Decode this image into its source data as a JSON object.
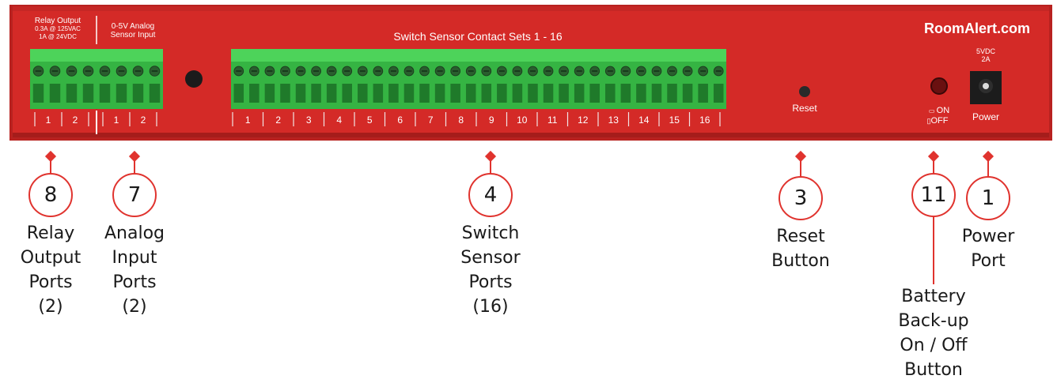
{
  "device": {
    "brand": "RoomAlert.com",
    "relay_header": [
      "Relay Output",
      "0.3A @ 125VAC",
      "1A @ 24VDC"
    ],
    "analog_header": [
      "0-5V Analog",
      "Sensor Input"
    ],
    "switch_header": "Switch Sensor Contact Sets 1 - 16",
    "relay_ports": [
      "1",
      "2"
    ],
    "analog_ports": [
      "1",
      "2"
    ],
    "switch_ports": [
      "1",
      "2",
      "3",
      "4",
      "5",
      "6",
      "7",
      "8",
      "9",
      "10",
      "11",
      "12",
      "13",
      "14",
      "15",
      "16"
    ],
    "reset_label": "Reset",
    "battery_on": "ON",
    "battery_off": "OFF",
    "power_spec": [
      "5VDC",
      "2A"
    ],
    "power_label": "Power",
    "colors": {
      "case": "#d42a27",
      "case_dark": "#a51d1b",
      "terminal": "#3ec94b",
      "callout": "#e0332e"
    }
  },
  "callouts": [
    {
      "id": "relay",
      "number": "8",
      "label": [
        "Relay",
        "Output",
        "Ports",
        "(2)"
      ]
    },
    {
      "id": "analog",
      "number": "7",
      "label": [
        "Analog",
        "Input",
        "Ports",
        "(2)"
      ]
    },
    {
      "id": "switch",
      "number": "4",
      "label": [
        "Switch",
        "Sensor",
        "Ports",
        "(16)"
      ]
    },
    {
      "id": "reset",
      "number": "3",
      "label": [
        "Reset",
        "Button"
      ]
    },
    {
      "id": "battery",
      "number": "11",
      "label": [
        "Battery",
        "Back-up",
        "On / Off",
        "Button"
      ]
    },
    {
      "id": "power",
      "number": "1",
      "label": [
        "Power",
        "Port"
      ]
    }
  ]
}
